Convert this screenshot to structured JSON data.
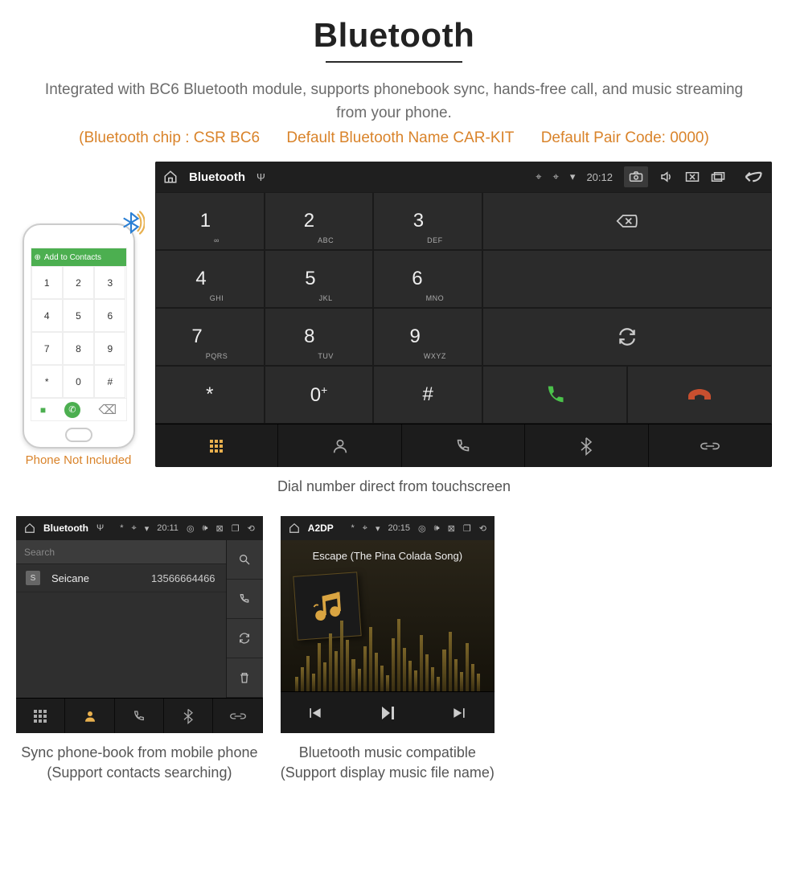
{
  "header": {
    "title": "Bluetooth",
    "description": "Integrated with BC6 Bluetooth module, supports phonebook sync, hands-free call, and music streaming from your phone.",
    "spec_chip": "(Bluetooth chip : CSR BC6",
    "spec_name": "Default Bluetooth Name CAR-KIT",
    "spec_code": "Default Pair Code: 0000)"
  },
  "phone": {
    "add_label": "Add to Contacts",
    "keys": [
      "1",
      "2",
      "3",
      "4",
      "5",
      "6",
      "7",
      "8",
      "9",
      "*",
      "0",
      "#"
    ],
    "not_included": "Phone Not Included"
  },
  "main_unit": {
    "app": "Bluetooth",
    "time": "20:12",
    "keys": [
      {
        "n": "1",
        "s": "∞"
      },
      {
        "n": "2",
        "s": "ABC"
      },
      {
        "n": "3",
        "s": "DEF"
      },
      {
        "n": "4",
        "s": "GHI"
      },
      {
        "n": "5",
        "s": "JKL"
      },
      {
        "n": "6",
        "s": "MNO"
      },
      {
        "n": "7",
        "s": "PQRS"
      },
      {
        "n": "8",
        "s": "TUV"
      },
      {
        "n": "9",
        "s": "WXYZ"
      },
      {
        "n": "*",
        "s": ""
      },
      {
        "n": "0",
        "s": "+"
      },
      {
        "n": "#",
        "s": ""
      }
    ],
    "caption": "Dial number direct from touchscreen"
  },
  "contacts_panel": {
    "app": "Bluetooth",
    "time": "20:11",
    "search_placeholder": "Search",
    "contact_badge": "S",
    "contact_name": "Seicane",
    "contact_number": "13566664466",
    "caption_l1": "Sync phone-book from mobile phone",
    "caption_l2": "(Support contacts searching)"
  },
  "music_panel": {
    "app": "A2DP",
    "time": "20:15",
    "song": "Escape (The Pina Colada Song)",
    "caption_l1": "Bluetooth music compatible",
    "caption_l2": "(Support display music file name)"
  },
  "eq_heights": [
    18,
    30,
    44,
    22,
    60,
    36,
    72,
    50,
    88,
    64,
    40,
    28,
    56,
    80,
    48,
    32,
    20,
    66,
    90,
    54,
    38,
    26,
    70,
    46,
    30,
    18,
    52,
    74,
    40,
    24,
    60,
    34,
    22
  ]
}
